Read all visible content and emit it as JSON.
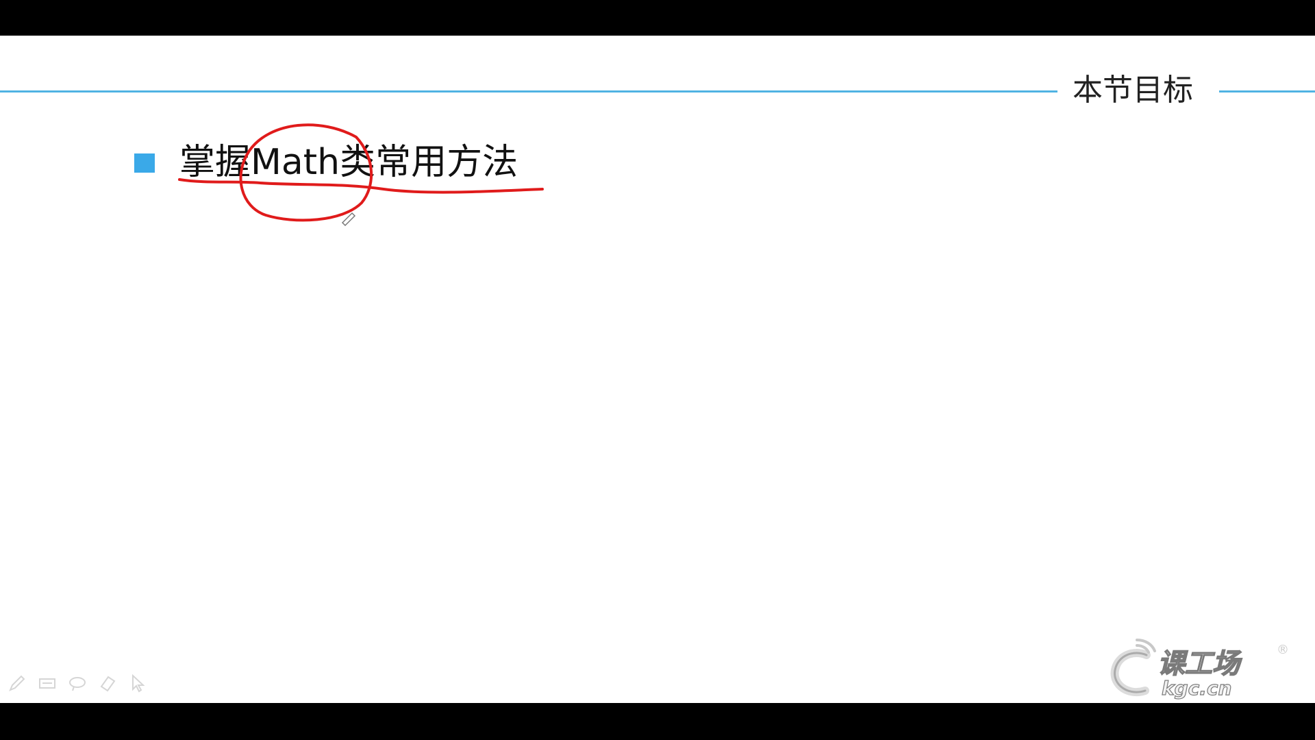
{
  "slide": {
    "section_title": "本节目标",
    "bullets": [
      {
        "text": "掌握Math类常用方法"
      }
    ]
  },
  "toolbar": {
    "tools": [
      {
        "icon": "pen-icon"
      },
      {
        "icon": "highlighter-icon"
      },
      {
        "icon": "lasso-icon"
      },
      {
        "icon": "eraser-icon"
      },
      {
        "icon": "pointer-arrow-icon"
      }
    ]
  },
  "brand": {
    "logo_text": "课工场",
    "logo_domain": "kgc.cn",
    "registered_mark": "®"
  },
  "colors": {
    "accent": "#4fb3e3",
    "bullet": "#3aa9e8",
    "annotation_ink": "#e01b1b"
  }
}
